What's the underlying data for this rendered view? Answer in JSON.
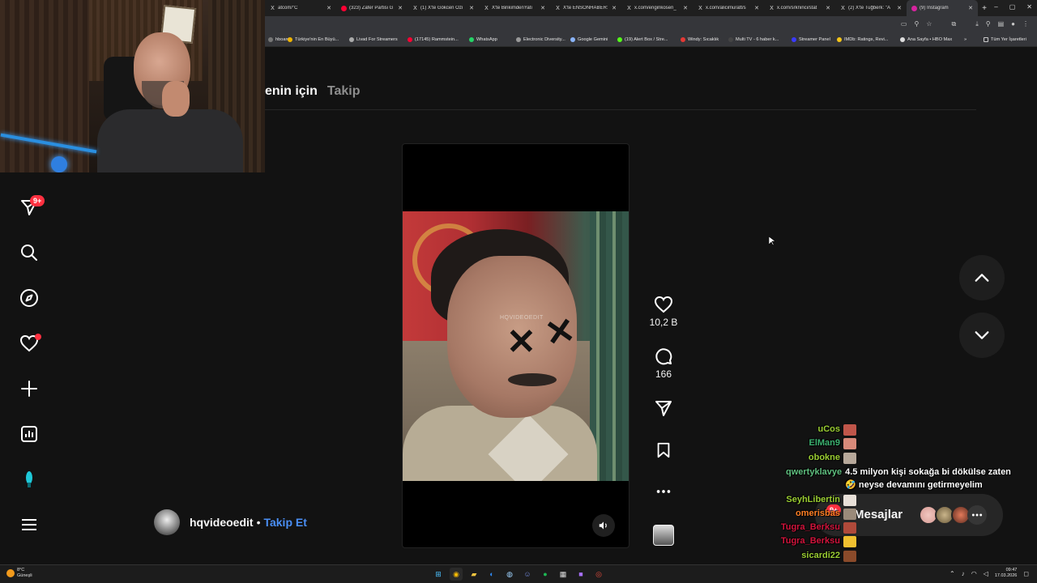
{
  "browser": {
    "tabs": [
      {
        "label": "atcom/\"C",
        "fav": "X",
        "favcolor": "#1f1f1f"
      },
      {
        "label": "(323) Zafer Partisi G",
        "fav": "",
        "favcolor": "#ff0033"
      },
      {
        "label": "(1) X'te Gökcen Özi",
        "fav": "X",
        "favcolor": "#1f1f1f"
      },
      {
        "label": "X'te BirikimdenYatı",
        "fav": "X",
        "favcolor": "#1f1f1f"
      },
      {
        "label": "X'te ENSONHABER:",
        "fav": "X",
        "favcolor": "#1f1f1f"
      },
      {
        "label": "x.com/enginkosen_",
        "fav": "X",
        "favcolor": "#1f1f1f"
      },
      {
        "label": "x.com/alicimuratt/s",
        "fav": "X",
        "favcolor": "#1f1f1f"
      },
      {
        "label": "x.com/srkninci/stat",
        "fav": "X",
        "favcolor": "#1f1f1f"
      },
      {
        "label": "(2) X'te Tuğberk: \"A",
        "fav": "X",
        "favcolor": "#1f1f1f"
      },
      {
        "label": "(9) Instagram",
        "fav": "",
        "favcolor": "#d6249f",
        "active": true
      }
    ],
    "new_tab": "+",
    "window_controls": [
      "–",
      "▢",
      "✕"
    ],
    "bookmarks": [
      {
        "label": "hboard",
        "color": "#777"
      },
      {
        "label": "Türkiye'nin En Büyü...",
        "color": "#f0b400"
      },
      {
        "label": "Livad For Streamers",
        "color": "#aaa"
      },
      {
        "label": "(17145) Rammstein...",
        "color": "#ff0033"
      },
      {
        "label": "WhatsApp",
        "color": "#25d366"
      },
      {
        "label": "Electronic Diversity...",
        "color": "#999"
      },
      {
        "label": "Google Gemini",
        "color": "#8ab4f8"
      },
      {
        "label": "(19) Alert Box / Stre...",
        "color": "#53fc18"
      },
      {
        "label": "Windy: Sıcaklık",
        "color": "#e53935"
      },
      {
        "label": "Multi TV - 6 haber k...",
        "color": "#444"
      },
      {
        "label": "Streamer Panel",
        "color": "#3a3aff"
      },
      {
        "label": "IMDb: Ratings, Revi...",
        "color": "#f5c518"
      },
      {
        "label": "Ana Sayfa • HBO Max",
        "color": "#ddd"
      }
    ],
    "bookmarks_more": "»",
    "all_bookmarks": "Tüm Yer İşaretleri"
  },
  "instagram": {
    "feed_tabs": [
      "enin için",
      "Takip"
    ],
    "nav": {
      "messages_badge": "9+",
      "icons": [
        "send-icon",
        "search-icon",
        "explore-icon",
        "heart-icon",
        "create-icon",
        "insights-icon",
        "threads-icon",
        "menu-icon"
      ]
    },
    "reel": {
      "watermark": "HQVIDEOEDIT",
      "mark_left": "✕",
      "mark_right": "✕"
    },
    "actions": {
      "likes": "10,2 B",
      "comments": "166"
    },
    "author": {
      "username": "hqvideoedit",
      "separator": "•",
      "follow_label": "Takip Et"
    },
    "messages": {
      "label": "Mesajlar",
      "badge": "9+"
    }
  },
  "chat": {
    "lines": [
      {
        "name": "uCos",
        "color": "#9acd32"
      },
      {
        "name": "ElMan9",
        "color": "#3cb371"
      },
      {
        "name": "obokne",
        "color": "#9acd32"
      },
      {
        "name": "qwertyklavye",
        "color": "#5fbf7f",
        "message": "4.5 milyon kişi sokağa bi dökülse zaten 🤣 neyse devamını getirmeyelim"
      },
      {
        "name": "SeyhLibertin",
        "color": "#9acd32"
      },
      {
        "name": "omerisbas",
        "color": "#ff7f24"
      },
      {
        "name": "Tugra_Berksu",
        "color": "#d2143c"
      },
      {
        "name": "Tugra_Berksu",
        "color": "#d2143c"
      },
      {
        "name": "sicardi22",
        "color": "#9acd32"
      }
    ]
  },
  "taskbar": {
    "weather_temp": "8°C",
    "weather_desc": "Güneşli",
    "time": "09:47",
    "date": "17.03.2026"
  }
}
